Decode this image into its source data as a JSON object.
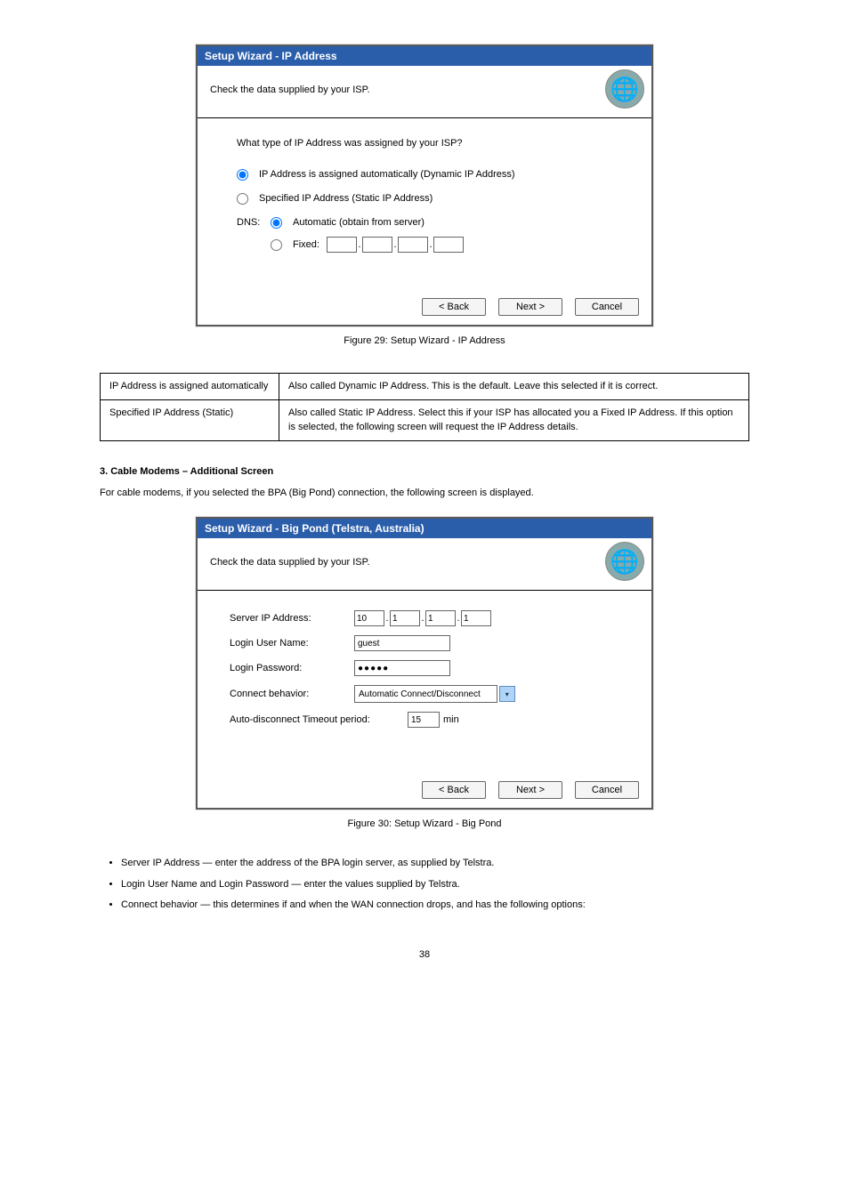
{
  "page_footer": "38",
  "dialog1": {
    "title": "Setup Wizard - IP Address",
    "subtitle": "Check the data supplied by your ISP.",
    "question": "What type of IP Address was assigned by your ISP?",
    "opt_dynamic": "IP Address is assigned automatically (Dynamic IP Address)",
    "opt_static": "Specified IP Address (Static IP Address)",
    "dns_label": "DNS:",
    "dns_auto": "Automatic (obtain from server)",
    "dns_fixed": "Fixed:",
    "btn_back": "< Back",
    "btn_next": "Next >",
    "btn_cancel": "Cancel"
  },
  "figure1_caption": "Figure 29: Setup Wizard - IP Address",
  "table1": {
    "r1c1": "IP Address is assigned automatically",
    "r1c2": "Also called Dynamic IP Address. This is the default.  Leave this selected if it is correct.",
    "r2c1": "Specified IP Address (Static)",
    "r2c2": "Also called Static IP Address. Select this if your ISP has allocated you a Fixed IP Address. If this option is selected, the following screen will request the IP Address details."
  },
  "section_heading": "3. Cable Modems – Additional Screen",
  "section_para": "For cable modems, if you selected the BPA (Big Pond) connection, the following screen is displayed.",
  "dialog2": {
    "title": "Setup Wizard - Big Pond (Telstra, Australia)",
    "subtitle": "Check the data supplied by your ISP.",
    "server_ip_label": "Server IP Address:",
    "server_ip": [
      "10",
      "1",
      "1",
      "1"
    ],
    "login_user_label": "Login User Name:",
    "login_user_value": "guest",
    "login_pwd_label": "Login Password:",
    "login_pwd_masked": "●●●●●",
    "connect_label": "Connect behavior:",
    "connect_value": "Automatic Connect/Disconnect",
    "timeout_label_a": "Auto-disconnect Timeout period:",
    "timeout_value": "15",
    "timeout_unit": "min",
    "btn_back": "< Back",
    "btn_next": "Next >",
    "btn_cancel": "Cancel"
  },
  "figure2_caption": "Figure 30: Setup Wizard - Big Pond",
  "bullets": [
    "Server IP Address — enter the address of the BPA login server, as supplied by Telstra.",
    "Login User Name and Login Password — enter the values supplied by Telstra.",
    "Connect behavior — this determines if and when the WAN connection drops, and has the following options:"
  ]
}
